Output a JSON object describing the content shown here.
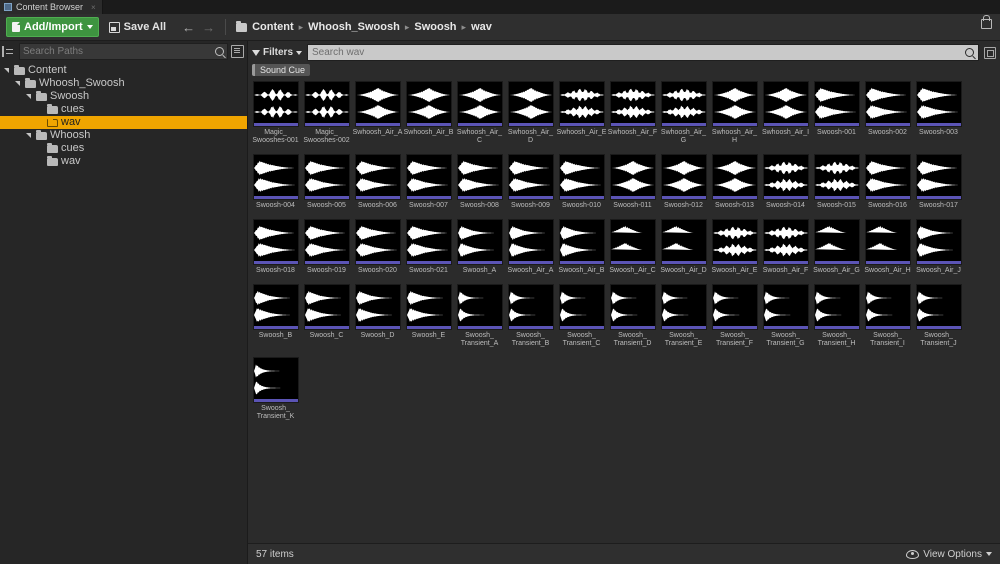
{
  "window": {
    "tab_title": "Content Browser",
    "tab_icon": "content-browser-icon",
    "tab_close": "×"
  },
  "toolbar": {
    "add_import_label": "Add/Import",
    "add_import_color": "#3e9440",
    "save_all_label": "Save All",
    "back_arrow": "←",
    "forward_arrow": "→",
    "breadcrumbs": [
      "Content",
      "Whoosh_Swoosh",
      "Swoosh",
      "wav"
    ],
    "crumb_separator": "▸",
    "lock_icon": "lock-icon"
  },
  "sidebar": {
    "search_placeholder": "Search Paths",
    "tree": [
      {
        "label": "Content",
        "depth": 0,
        "expanded": true,
        "selected": false
      },
      {
        "label": "Whoosh_Swoosh",
        "depth": 1,
        "expanded": true,
        "selected": false
      },
      {
        "label": "Swoosh",
        "depth": 2,
        "expanded": true,
        "selected": false
      },
      {
        "label": "cues",
        "depth": 3,
        "expanded": false,
        "selected": false
      },
      {
        "label": "wav",
        "depth": 3,
        "expanded": false,
        "selected": true
      },
      {
        "label": "Whoosh",
        "depth": 2,
        "expanded": true,
        "selected": false
      },
      {
        "label": "cues",
        "depth": 3,
        "expanded": false,
        "selected": false
      },
      {
        "label": "wav",
        "depth": 3,
        "expanded": false,
        "selected": false
      }
    ],
    "selected_color": "#f0a500"
  },
  "assetbar": {
    "filters_label": "Filters",
    "search_placeholder": "Search wav",
    "chips": [
      {
        "label": "Sound Cue",
        "color": "#9a9a9a"
      }
    ]
  },
  "assets": {
    "accent_color": "#5b54b5",
    "items": [
      {
        "name": "Magic_Swooshes-001",
        "wave": "pulse"
      },
      {
        "name": "Magic_Swooshes-002",
        "wave": "pulse"
      },
      {
        "name": "Swhoosh_Air_A",
        "wave": "lens"
      },
      {
        "name": "Swhoosh_Air_B",
        "wave": "lens"
      },
      {
        "name": "Swhoosh_Air_C",
        "wave": "lens"
      },
      {
        "name": "Swhoosh_Air_D",
        "wave": "lens"
      },
      {
        "name": "Swhoosh_Air_E",
        "wave": "burst"
      },
      {
        "name": "Swhoosh_Air_F",
        "wave": "burst"
      },
      {
        "name": "Swhoosh_Air_G",
        "wave": "burst"
      },
      {
        "name": "Swhoosh_Air_H",
        "wave": "lens"
      },
      {
        "name": "Swhoosh_Air_I",
        "wave": "lens"
      },
      {
        "name": "Swoosh-001",
        "wave": "taper"
      },
      {
        "name": "Swoosh-002",
        "wave": "taper"
      },
      {
        "name": "Swoosh-003",
        "wave": "taper"
      },
      {
        "name": "Swoosh-004",
        "wave": "taper"
      },
      {
        "name": "Swoosh-005",
        "wave": "taper"
      },
      {
        "name": "Swoosh-006",
        "wave": "taper"
      },
      {
        "name": "Swoosh-007",
        "wave": "taper"
      },
      {
        "name": "Swoosh-008",
        "wave": "taper"
      },
      {
        "name": "Swoosh-009",
        "wave": "taper"
      },
      {
        "name": "Swoosh-010",
        "wave": "taper"
      },
      {
        "name": "Swoosh-011",
        "wave": "lens"
      },
      {
        "name": "Swoosh-012",
        "wave": "lens"
      },
      {
        "name": "Swoosh-013",
        "wave": "lens"
      },
      {
        "name": "Swoosh-014",
        "wave": "burst"
      },
      {
        "name": "Swoosh-015",
        "wave": "burst"
      },
      {
        "name": "Swoosh-016",
        "wave": "taper"
      },
      {
        "name": "Swoosh-017",
        "wave": "taper"
      },
      {
        "name": "Swoosh-018",
        "wave": "taper"
      },
      {
        "name": "Swoosh-019",
        "wave": "taper"
      },
      {
        "name": "Swoosh-020",
        "wave": "taper"
      },
      {
        "name": "Swoosh-021",
        "wave": "taper"
      },
      {
        "name": "Swoosh_A",
        "wave": "decay"
      },
      {
        "name": "Swoosh_Air_A",
        "wave": "decay"
      },
      {
        "name": "Swoosh_Air_B",
        "wave": "decay"
      },
      {
        "name": "Swoosh_Air_C",
        "wave": "blob"
      },
      {
        "name": "Swoosh_Air_D",
        "wave": "blob"
      },
      {
        "name": "Swoosh_Air_E",
        "wave": "burst"
      },
      {
        "name": "Swoosh_Air_F",
        "wave": "burst"
      },
      {
        "name": "Swoosh_Air_G",
        "wave": "blob"
      },
      {
        "name": "Swoosh_Air_H",
        "wave": "blob"
      },
      {
        "name": "Swoosh_Air_J",
        "wave": "decay"
      },
      {
        "name": "Swoosh_B",
        "wave": "decay"
      },
      {
        "name": "Swoosh_C",
        "wave": "decay"
      },
      {
        "name": "Swoosh_D",
        "wave": "decay"
      },
      {
        "name": "Swoosh_E",
        "wave": "decay"
      },
      {
        "name": "Swoosh_Transient_A",
        "wave": "spike"
      },
      {
        "name": "Swoosh_Transient_B",
        "wave": "spike"
      },
      {
        "name": "Swoosh_Transient_C",
        "wave": "spike"
      },
      {
        "name": "Swoosh_Transient_D",
        "wave": "spike"
      },
      {
        "name": "Swoosh_Transient_E",
        "wave": "spike"
      },
      {
        "name": "Swoosh_Transient_F",
        "wave": "spike"
      },
      {
        "name": "Swoosh_Transient_G",
        "wave": "spike"
      },
      {
        "name": "Swoosh_Transient_H",
        "wave": "spike"
      },
      {
        "name": "Swoosh_Transient_I",
        "wave": "spike"
      },
      {
        "name": "Swoosh_Transient_J",
        "wave": "spike"
      },
      {
        "name": "Swoosh_Transient_K",
        "wave": "spike"
      }
    ]
  },
  "footer": {
    "item_count": "57 items",
    "view_options_label": "View Options"
  }
}
